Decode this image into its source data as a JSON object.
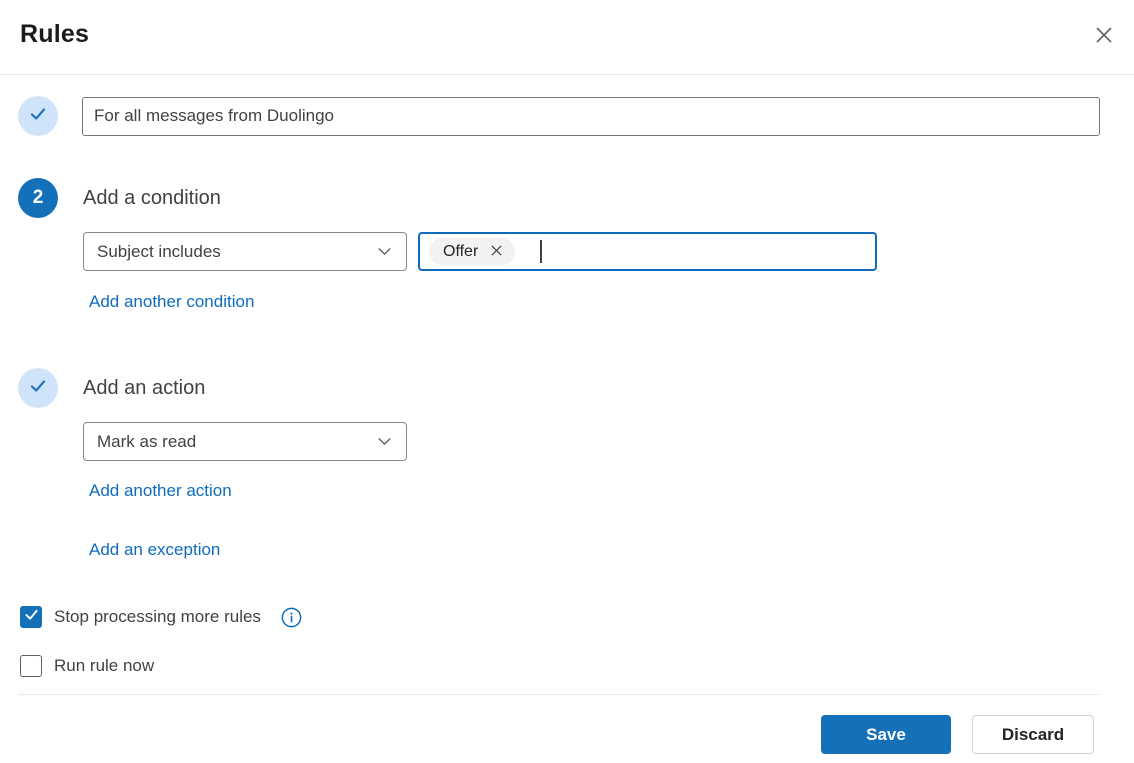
{
  "header": {
    "title": "Rules"
  },
  "rule_name": {
    "value": "For all messages from Duolingo"
  },
  "condition_step": {
    "number": "2",
    "heading": "Add a condition",
    "selected_condition": "Subject includes",
    "value_tags": [
      "Offer"
    ],
    "add_link": "Add another condition"
  },
  "action_step": {
    "heading": "Add an action",
    "selected_action": "Mark as read",
    "add_link": "Add another action",
    "exception_link": "Add an exception"
  },
  "options": {
    "stop_processing": {
      "label": "Stop processing more rules",
      "checked": true
    },
    "run_rule_now": {
      "label": "Run rule now",
      "checked": false
    }
  },
  "footer": {
    "save": "Save",
    "discard": "Discard"
  },
  "icons": {
    "close": "✕",
    "chevron_down": "⌄",
    "checkmark": "✓",
    "tag_dismiss": "✕",
    "info": "ⓘ"
  },
  "colors": {
    "primary_blue": "#1470b8",
    "link_blue": "#0f6cbd",
    "focus_border_blue": "#0f6cbd",
    "badge_light_blue": "#cfe4fa",
    "tag_background": "#f3f2f1",
    "divider": "#e8e8e8"
  }
}
